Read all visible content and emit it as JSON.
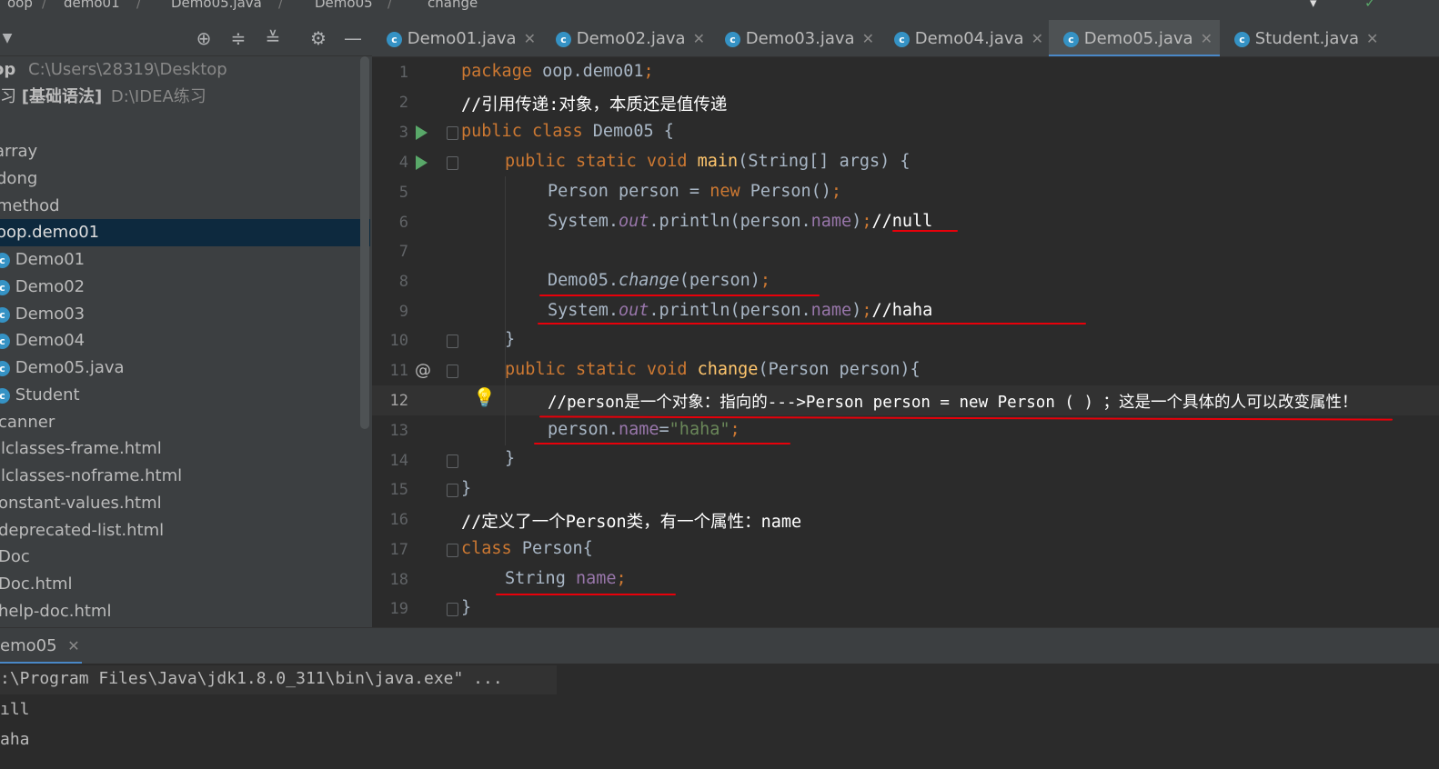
{
  "breadcrumb": {
    "items": [
      "oop",
      "demo01",
      "Demo05.java",
      "Demo05",
      "change"
    ]
  },
  "sidebar": {
    "toolbar_icons": [
      "chevron-down-icon",
      "locate-icon",
      "expand-all-icon",
      "collapse-all-icon",
      "gear-icon",
      "minimize-icon"
    ],
    "project_root": {
      "name": "op",
      "path": "C:\\Users\\28319\\Desktop"
    },
    "project_second": {
      "prefix": "习",
      "name": "[基础语法]",
      "path": "D:\\IDEA练习"
    },
    "items": [
      {
        "label": "array"
      },
      {
        "label": "dong"
      },
      {
        "label": "method"
      },
      {
        "label": "oop.demo01",
        "selected": true
      },
      {
        "label": "Demo01",
        "icon": "class-icon"
      },
      {
        "label": "Demo02",
        "icon": "class-icon"
      },
      {
        "label": "Demo03",
        "icon": "class-icon"
      },
      {
        "label": "Demo04",
        "icon": "class-icon"
      },
      {
        "label": "Demo05.java",
        "icon": "class-icon"
      },
      {
        "label": "Student",
        "icon": "class-icon"
      },
      {
        "label": "canner"
      },
      {
        "label": "llclasses-frame.html"
      },
      {
        "label": "llclasses-noframe.html"
      },
      {
        "label": "onstant-values.html"
      },
      {
        "label": "deprecated-list.html"
      },
      {
        "label": "Doc"
      },
      {
        "label": "Doc.html"
      },
      {
        "label": "help-doc.html"
      }
    ]
  },
  "tabs": [
    {
      "label": "Demo01.java"
    },
    {
      "label": "Demo02.java"
    },
    {
      "label": "Demo03.java"
    },
    {
      "label": "Demo04.java"
    },
    {
      "label": "Demo05.java",
      "active": true
    },
    {
      "label": "Student.java"
    }
  ],
  "editor": {
    "current_line": 12,
    "lines": [
      {
        "n": "1"
      },
      {
        "n": "2"
      },
      {
        "n": "3"
      },
      {
        "n": "4"
      },
      {
        "n": "5"
      },
      {
        "n": "6"
      },
      {
        "n": "7"
      },
      {
        "n": "8"
      },
      {
        "n": "9"
      },
      {
        "n": "10"
      },
      {
        "n": "11"
      },
      {
        "n": "12"
      },
      {
        "n": "13"
      },
      {
        "n": "14"
      },
      {
        "n": "15"
      },
      {
        "n": "16"
      },
      {
        "n": "17"
      },
      {
        "n": "18"
      },
      {
        "n": "19"
      }
    ],
    "code": {
      "l1_kw": "package",
      "l1_rest": " oop.demo01",
      "l1_semi": ";",
      "l2": "//引用传递:对象，本质还是值传递",
      "l3_kw": "public class",
      "l3_rest": " Demo05 {",
      "l4_kw": "public static void",
      "l4_fn": " main",
      "l4_rest": "(String[] args) {",
      "l5_a": "Person person = ",
      "l5_kw": "new",
      "l5_b": " Person()",
      "l5_semi": ";",
      "l6_a": "System.",
      "l6_out": "out",
      "l6_b": ".println(person.",
      "l6_fld": "name",
      "l6_c": ")",
      "l6_semi": ";",
      "l6_cm": "//null",
      "l8_a": "Demo05.",
      "l8_fn": "change",
      "l8_b": "(person)",
      "l8_semi": ";",
      "l9_a": "System.",
      "l9_out": "out",
      "l9_b": ".println(person.",
      "l9_fld": "name",
      "l9_c": ")",
      "l9_semi": ";",
      "l9_cm": "//haha",
      "l10": "}",
      "l11_kw": "public static void",
      "l11_fn": " change",
      "l11_rest": "(Person person){",
      "l12": "//person是一个对象：指向的--->Person person = new Person ( ) ；这是一个具体的人可以改变属性！",
      "l13_a": "person.",
      "l13_fld": "name",
      "l13_eq": "=",
      "l13_str": "\"haha\"",
      "l13_semi": ";",
      "l14": "}",
      "l15": "}",
      "l16": "//定义了一个Person类，有一个属性：name",
      "l17_kw": "class",
      "l17_rest": " Person{",
      "l18_a": "String ",
      "l18_fld": "name",
      "l18_semi": ";",
      "l19": "}"
    },
    "gutter": {
      "run_icon": "run-icon",
      "override_marker": "@",
      "bulb": "lightbulb-icon"
    }
  },
  "run_panel": {
    "tab_label": "emo05",
    "lines": [
      ":\\Program Files\\Java\\jdk1.8.0_311\\bin\\java.exe\" ...",
      "ıll",
      "aha"
    ]
  },
  "colors": {
    "keyword": "#cc7832",
    "function": "#ffc66d",
    "field": "#9876aa",
    "string": "#6a8759",
    "annotation_underline": "#e8000a",
    "selection": "#0d293e"
  }
}
